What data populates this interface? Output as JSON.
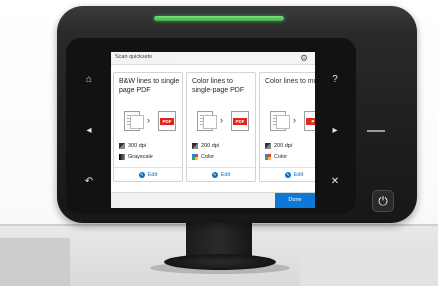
{
  "screen": {
    "title": "Scan quicksets",
    "settings_icon": "gear-icon",
    "done_label": "Done"
  },
  "cards": [
    {
      "title": "B&W lines to single page PDF",
      "resolution": "300 dpi",
      "color_mode": "Grayscale",
      "color_mode_icon": "grayscale-icon",
      "output_label": "PDF",
      "edit_label": "Edit"
    },
    {
      "title": "Color lines to single-page PDF",
      "resolution": "200 dpi",
      "color_mode": "Color",
      "color_mode_icon": "color-icon",
      "output_label": "PDF",
      "edit_label": "Edit"
    },
    {
      "title": "Color lines to mu",
      "resolution": "200 dpi",
      "color_mode": "Color",
      "color_mode_icon": "color-icon",
      "output_label": "P",
      "edit_label": "Edit"
    }
  ],
  "hardware_buttons": {
    "home": "⌂",
    "back_left": "◂",
    "undo": "↶",
    "help": "?",
    "forward_right": "▸",
    "cancel": "✕",
    "power": "⏻"
  },
  "colors": {
    "accent": "#0a7ad6",
    "status_light": "#4fc152",
    "pdf_red": "#e2231a"
  }
}
